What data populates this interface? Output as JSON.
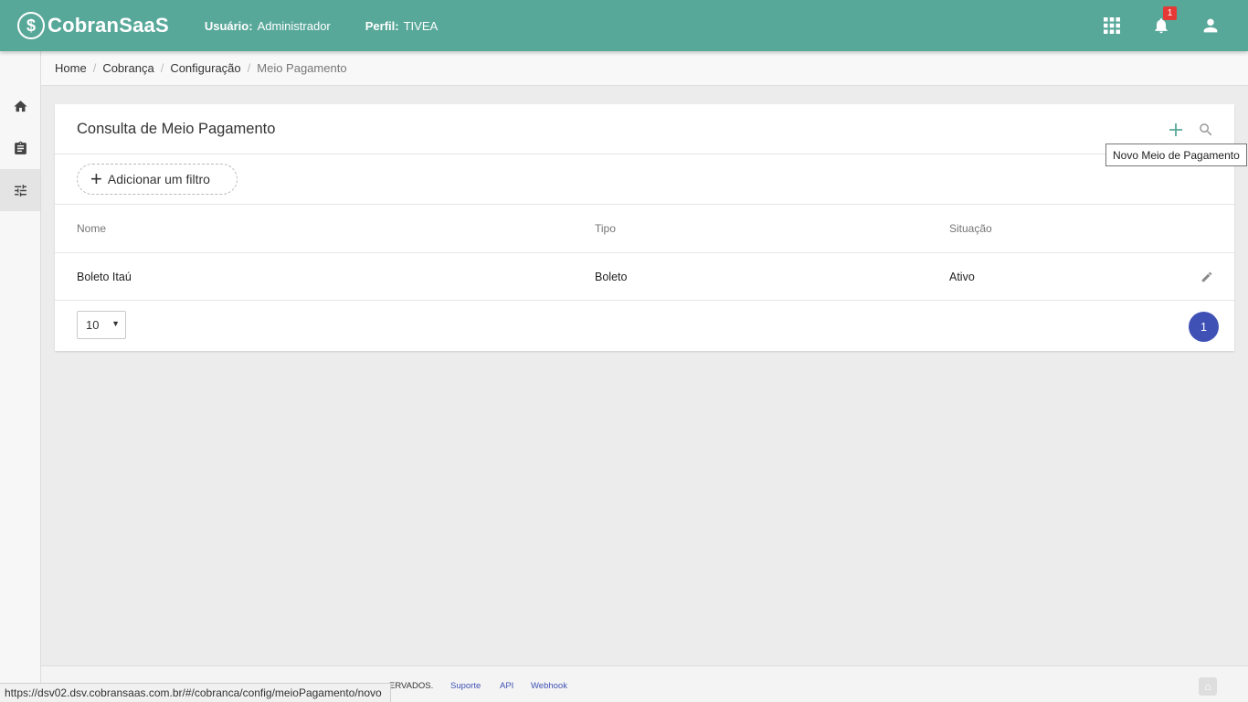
{
  "header": {
    "logo_text": "CobranSaaS",
    "logo_symbol": "$",
    "user_label": "Usuário:",
    "user_value": "Administrador",
    "profile_label": "Perfil:",
    "profile_value": "TIVEA",
    "notification_count": "1",
    "icons": [
      "apps-grid-icon",
      "bell-icon",
      "user-account-icon"
    ]
  },
  "sidebar": {
    "items": [
      {
        "icon": "home-icon",
        "active": false
      },
      {
        "icon": "clipboard-icon",
        "active": false
      },
      {
        "icon": "settings-sliders-icon",
        "active": true
      }
    ]
  },
  "breadcrumb": {
    "items": [
      "Home",
      "Cobrança",
      "Configuração"
    ],
    "current": "Meio Pagamento"
  },
  "card": {
    "title": "Consulta de Meio Pagamento",
    "add_filter_label": "Adicionar um filtro",
    "columns": [
      "Nome",
      "Tipo",
      "Situação"
    ],
    "rows": [
      {
        "nome": "Boleto Itaú",
        "tipo": "Boleto",
        "situacao": "Ativo"
      }
    ],
    "page_size": "10",
    "current_page": "1"
  },
  "tooltip": "Novo Meio de Pagamento",
  "footer": {
    "text": "ERVADOS.",
    "links": [
      "Suporte",
      "API",
      "Webhook"
    ]
  },
  "status_url": "https://dsv02.dsv.cobransaas.com.br/#/cobranca/config/meioPagamento/novo",
  "colors": {
    "header_bg": "#58a89a",
    "accent": "#3f51b5",
    "badge": "#e53935"
  }
}
